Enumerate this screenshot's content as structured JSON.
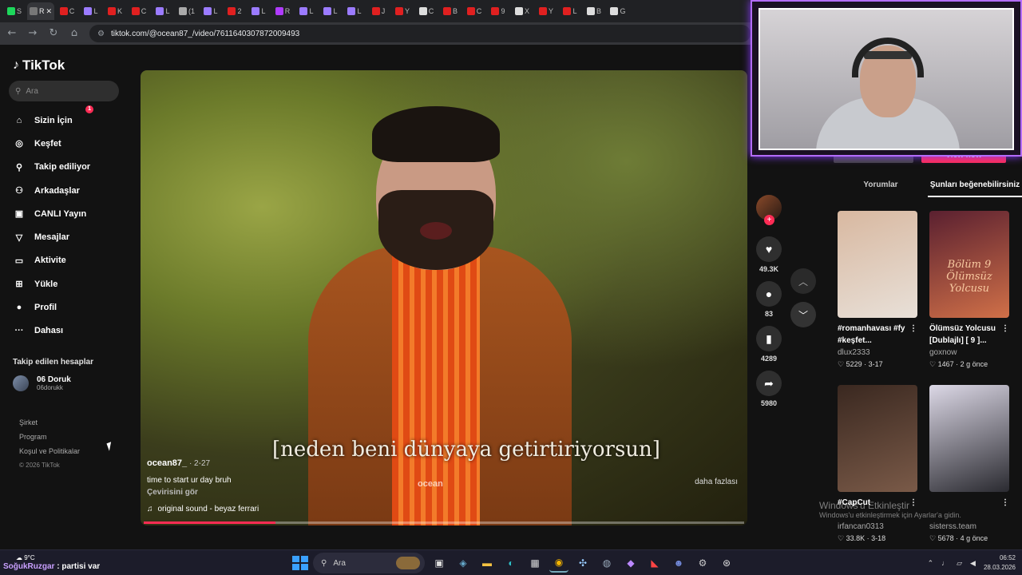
{
  "browser": {
    "tabs": [
      {
        "label": "S",
        "color": "#1dd75b"
      },
      {
        "label": "R",
        "color": "#777",
        "active": true
      },
      {
        "label": "C",
        "color": "#e02020"
      },
      {
        "label": "L",
        "color": "#9b7bff"
      },
      {
        "label": "K",
        "color": "#e02020"
      },
      {
        "label": "C",
        "color": "#e02020"
      },
      {
        "label": "L",
        "color": "#9b7bff"
      },
      {
        "label": "(1",
        "color": "#aaa"
      },
      {
        "label": "L",
        "color": "#9b7bff"
      },
      {
        "label": "2",
        "color": "#e02020"
      },
      {
        "label": "L",
        "color": "#9b7bff"
      },
      {
        "label": "R",
        "color": "#b03bff"
      },
      {
        "label": "L",
        "color": "#9b7bff"
      },
      {
        "label": "L",
        "color": "#9b7bff"
      },
      {
        "label": "L",
        "color": "#9b7bff"
      },
      {
        "label": "J",
        "color": "#e02020"
      },
      {
        "label": "Y",
        "color": "#e02020"
      },
      {
        "label": "C",
        "color": "#ddd"
      },
      {
        "label": "B",
        "color": "#e02020"
      },
      {
        "label": "C",
        "color": "#e02020"
      },
      {
        "label": "9",
        "color": "#e02020"
      },
      {
        "label": "X",
        "color": "#ddd"
      },
      {
        "label": "Y",
        "color": "#e02020"
      },
      {
        "label": "L",
        "color": "#e02020"
      },
      {
        "label": "B",
        "color": "#ddd"
      },
      {
        "label": "G",
        "color": "#ddd"
      }
    ],
    "url": "tiktok.com/@ocean87_/video/7611640307872009493"
  },
  "tiktok": {
    "logo": "TikTok",
    "search_placeholder": "Ara",
    "nav": [
      {
        "label": "Sizin İçin",
        "icon": "home-icon",
        "glyph": "⌂"
      },
      {
        "label": "Keşfet",
        "icon": "compass-icon",
        "glyph": "◎"
      },
      {
        "label": "Takip ediliyor",
        "icon": "user-plus-icon",
        "glyph": "⚲"
      },
      {
        "label": "Arkadaşlar",
        "icon": "friends-icon",
        "glyph": "⚇"
      },
      {
        "label": "CANLI Yayın",
        "icon": "live-tv-icon",
        "glyph": "▣"
      },
      {
        "label": "Mesajlar",
        "icon": "message-icon",
        "glyph": "▽"
      },
      {
        "label": "Aktivite",
        "icon": "activity-icon",
        "glyph": "▭",
        "badge": "1"
      },
      {
        "label": "Yükle",
        "icon": "upload-icon",
        "glyph": "⊞"
      },
      {
        "label": "Profil",
        "icon": "profile-avatar-icon",
        "glyph": "●"
      },
      {
        "label": "Dahası",
        "icon": "more-icon",
        "glyph": "···"
      }
    ],
    "followed_title": "Takip edilen hesaplar",
    "followed": [
      {
        "name": "06 Doruk",
        "handle": "06dorukk"
      }
    ],
    "footer": {
      "company": "Şirket",
      "program": "Program",
      "terms": "Koşul ve Politikalar",
      "copyright": "© 2026 TikTok"
    },
    "video": {
      "subtitle": "[neden beni dünyaya getirtiriyorsun]",
      "watermark": "ocean",
      "author": "ocean87_",
      "date": "· 2-27",
      "description": "time to start ur day bruh",
      "translate": "Çevirisini gör",
      "sound": "original sound - beyaz ferrari",
      "more": "daha fazlası",
      "progress": 0.22
    },
    "actions": {
      "likes": "49.3K",
      "comments": "83",
      "saves": "4289",
      "shares": "5980"
    },
    "right_panel": {
      "view_now": "View now",
      "tabs": [
        "Yorumlar",
        "Şunları beğenebilirsiniz"
      ],
      "cards": [
        {
          "title": "#romanhavası #fy #keşfet...",
          "user": "dlux2333",
          "likes": "5229",
          "date": "3-17",
          "colors": [
            "#d8b8a0",
            "#e8e0d8"
          ]
        },
        {
          "title": "Ölümsüz Yolcusu [Dublajlı] [ 9 ]...",
          "user": "goxnow",
          "likes": "1467",
          "date": "2 g önce",
          "colors": [
            "#5a2030",
            "#d07048"
          ],
          "overlay": "Bölüm 9 Ölümsüz Yolcusu"
        },
        {
          "title": "#CapCut",
          "user": "irfancan0313",
          "likes": "33.8K",
          "date": "3-18",
          "colors": [
            "#3a2820",
            "#7a5a48"
          ]
        },
        {
          "title": "",
          "user": "sisterss.team",
          "likes": "5678",
          "date": "4 g önce",
          "colors": [
            "#dcd8e6",
            "#2a2a30"
          ]
        }
      ]
    }
  },
  "windows": {
    "activate_title": "Windows'u Etkinleştir",
    "activate_sub": "Windows'u etkinleştirmek için Ayarlar'a gidin.",
    "weather": "9°C",
    "ticker_user": "SoğukRuzgar",
    "ticker_text": ": partisi var",
    "search": "Ara",
    "time": "06:52",
    "date": "28.03.2026"
  }
}
